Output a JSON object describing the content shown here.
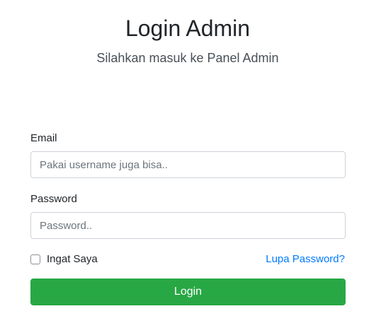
{
  "header": {
    "title": "Login Admin",
    "subtitle": "Silahkan masuk ke Panel Admin"
  },
  "form": {
    "email_label": "Email",
    "email_value": "",
    "email_placeholder": "Pakai username juga bisa..",
    "password_label": "Password",
    "password_value": "",
    "password_placeholder": "Password..",
    "remember_label": "Ingat Saya",
    "remember_checked": false,
    "forgot_label": "Lupa Password?",
    "submit_label": "Login"
  },
  "colors": {
    "primary_button": "#28a745",
    "link": "#007bff",
    "input_border": "#ced4da"
  }
}
